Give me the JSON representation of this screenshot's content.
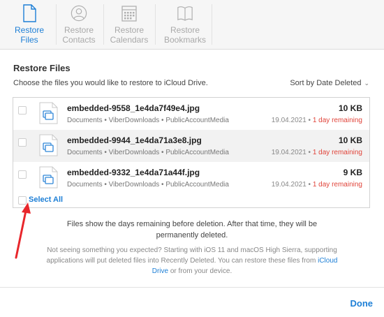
{
  "toolbar": {
    "tabs": [
      {
        "line1": "Restore",
        "line2": "Files",
        "icon": "file-icon",
        "active": true
      },
      {
        "line1": "Restore",
        "line2": "Contacts",
        "icon": "contact-icon",
        "active": false
      },
      {
        "line1": "Restore",
        "line2": "Calendars",
        "icon": "calendar-icon",
        "active": false
      },
      {
        "line1": "Restore",
        "line2": "Bookmarks",
        "icon": "book-icon",
        "active": false
      }
    ]
  },
  "main": {
    "title": "Restore Files",
    "subtitle": "Choose the files you would like to restore to iCloud Drive.",
    "sort_label": "Sort by Date Deleted",
    "files": [
      {
        "name": "embedded-9558_1e4da7f49e4.jpg",
        "path": "Documents • ViberDownloads • PublicAccountMedia",
        "size": "10 KB",
        "date": "19.04.2021",
        "remaining": "1 day remaining"
      },
      {
        "name": "embedded-9944_1e4da71a3e8.jpg",
        "path": "Documents • ViberDownloads • PublicAccountMedia",
        "size": "10 KB",
        "date": "19.04.2021",
        "remaining": "1 day remaining"
      },
      {
        "name": "embedded-9332_1e4da71a44f.jpg",
        "path": "Documents • ViberDownloads • PublicAccountMedia",
        "size": "9 KB",
        "date": "19.04.2021",
        "remaining": "1 day remaining"
      }
    ],
    "select_all": "Select All",
    "info_primary": "Files show the days remaining before deletion. After that time, they will be permanently deleted.",
    "info_secondary_1": "Not seeing something you expected? Starting with iOS 11 and macOS High Sierra, supporting applications will put deleted files into Recently Deleted. You can restore these files from ",
    "info_secondary_link": "iCloud Drive",
    "info_secondary_2": " or from your device."
  },
  "footer": {
    "done_label": "Done"
  },
  "colors": {
    "accent": "#1d7fd6",
    "warning": "#e0443a",
    "annotation_arrow": "#e8262b"
  }
}
